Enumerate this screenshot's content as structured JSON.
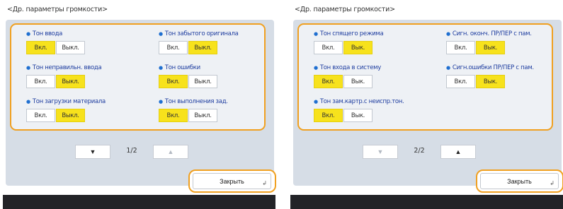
{
  "screens": [
    {
      "title": "<Др. параметры громкости>",
      "settings": [
        {
          "label": "Тон ввода",
          "on_label": "Вкл.",
          "off_label": "Выкл.",
          "selected": "on"
        },
        {
          "label": "Тон забытого оригинала",
          "on_label": "Вкл.",
          "off_label": "Выкл.",
          "selected": "off"
        },
        {
          "label": "Тон неправильн. ввода",
          "on_label": "Вкл.",
          "off_label": "Выкл.",
          "selected": "off"
        },
        {
          "label": "Тон ошибки",
          "on_label": "Вкл.",
          "off_label": "Выкл.",
          "selected": "on"
        },
        {
          "label": "Тон загрузки материала",
          "on_label": "Вкл.",
          "off_label": "Выкл.",
          "selected": "off"
        },
        {
          "label": "Тон выполнения зад.",
          "on_label": "Вкл.",
          "off_label": "Выкл.",
          "selected": "on"
        }
      ],
      "pager": {
        "prev_icon": "▼",
        "next_icon": "▲",
        "indicator": "1/2",
        "prev_enabled": true,
        "next_enabled": false
      },
      "close_label": "Закрыть",
      "close_icon": "↲"
    },
    {
      "title": "<Др. параметры громкости>",
      "settings": [
        {
          "label": "Тон спящего режима",
          "on_label": "Вкл.",
          "off_label": "Вык.",
          "selected": "off"
        },
        {
          "label": "Сигн. оконч. ПР/ПЕР с пам.",
          "on_label": "Вкл.",
          "off_label": "Вык.",
          "selected": "off"
        },
        {
          "label": "Тон входа в систему",
          "on_label": "Вкл.",
          "off_label": "Вык.",
          "selected": "on"
        },
        {
          "label": "Сигн.ошибки ПР/ПЕР с пам.",
          "on_label": "Вкл.",
          "off_label": "Вык.",
          "selected": "off"
        },
        {
          "label": "Тон зам.картр.с неиспр.тон.",
          "on_label": "Вкл.",
          "off_label": "Вык.",
          "selected": "on"
        }
      ],
      "pager": {
        "prev_icon": "▼",
        "next_icon": "▲",
        "indicator": "2/2",
        "prev_enabled": false,
        "next_enabled": true
      },
      "close_label": "Закрыть",
      "close_icon": "↲"
    }
  ],
  "colors": {
    "selected": "#f7e21c",
    "focus_border": "#f0a020",
    "label_blue": "#1f3ea0",
    "panel_bg": "#d6dde6"
  }
}
